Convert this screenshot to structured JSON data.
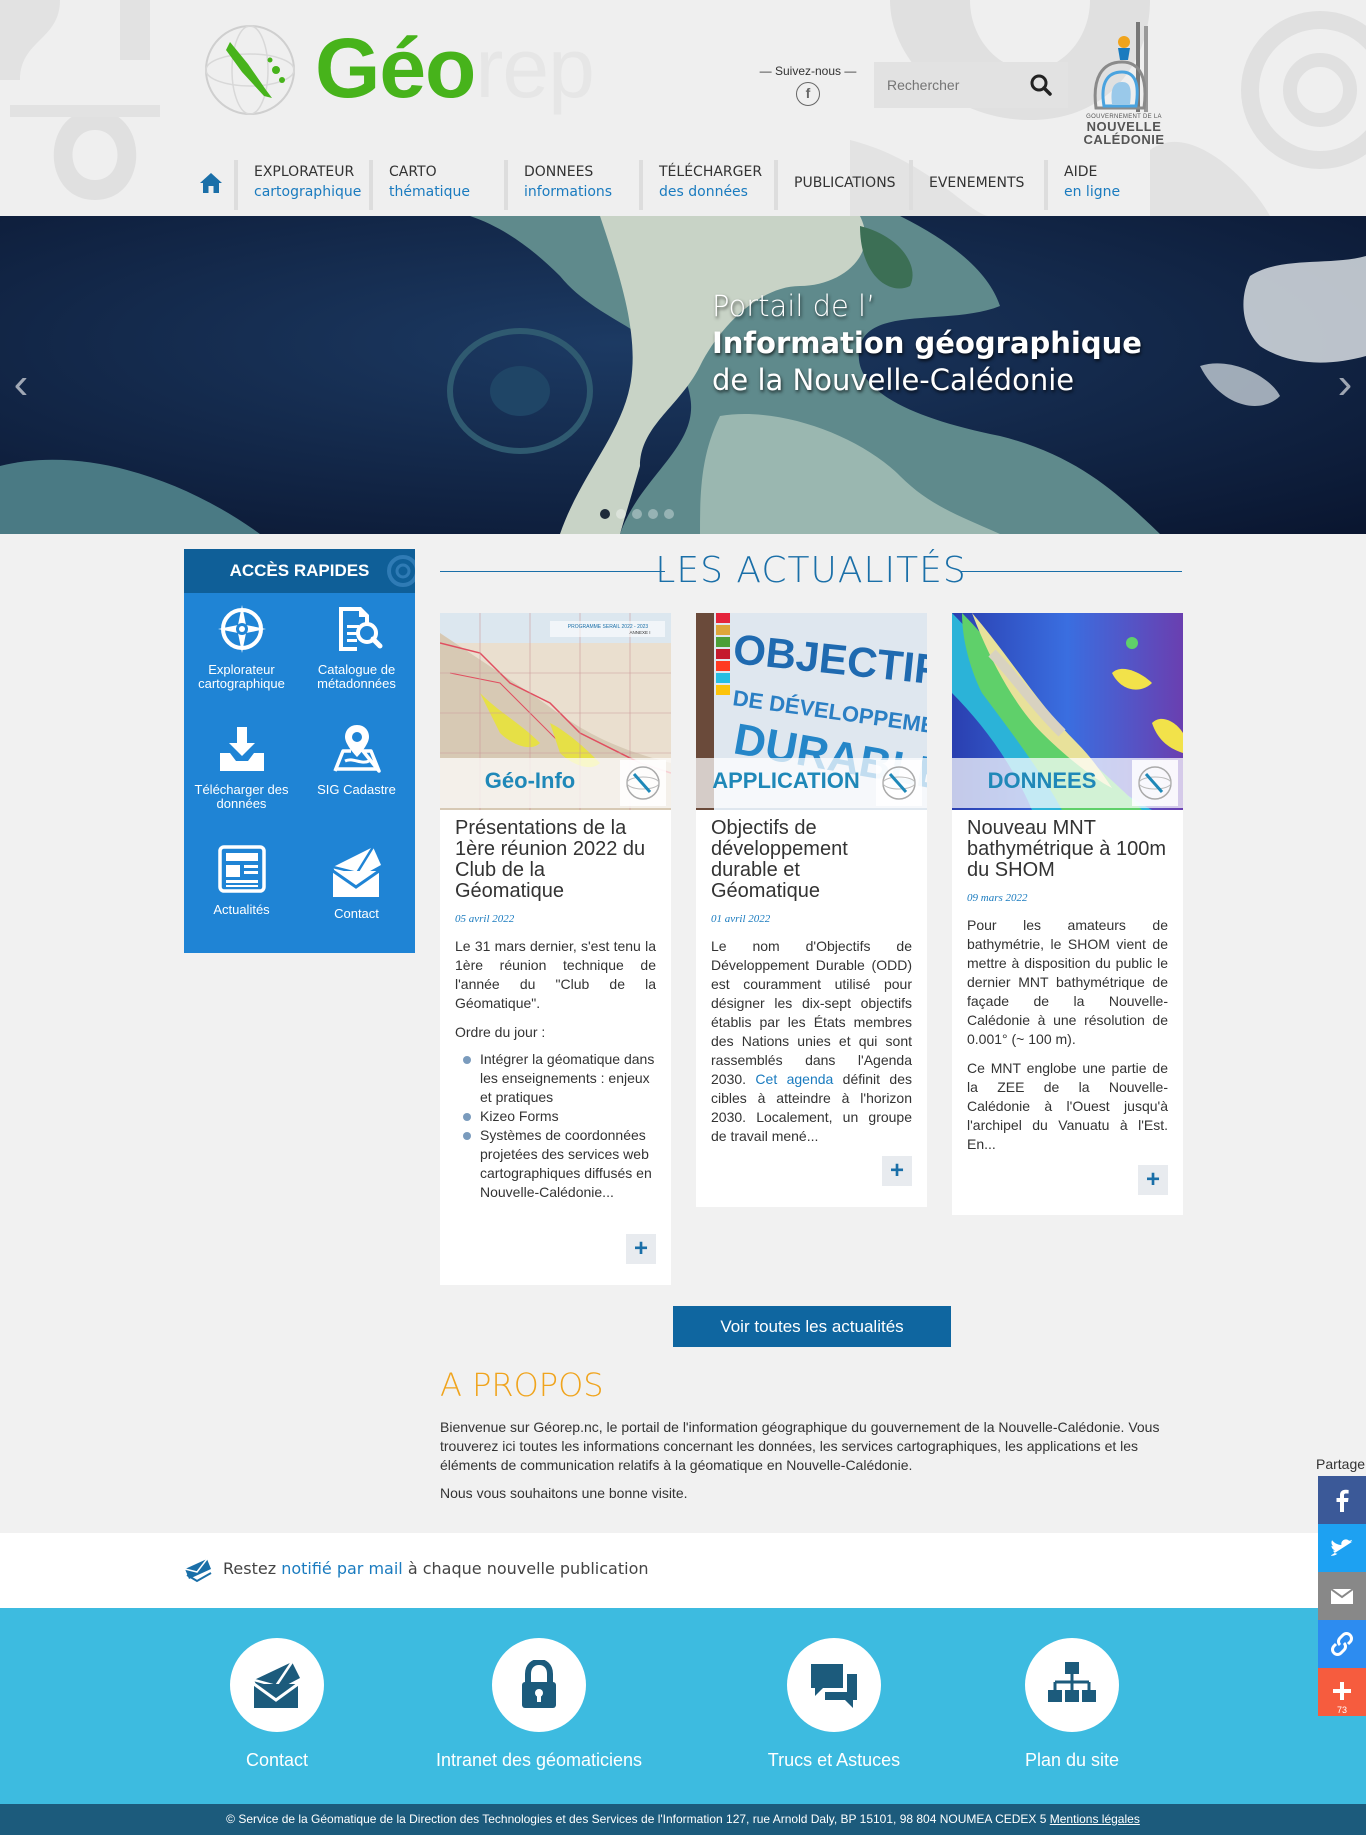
{
  "header": {
    "logo": {
      "part1": "Géo",
      "part2": "rep"
    },
    "follow_label": "Suivez-nous",
    "follow_icon": "facebook-icon",
    "search_placeholder": "Rechercher",
    "gov_logo": {
      "line1": "GOUVERNEMENT DE LA",
      "line2": "NOUVELLE",
      "line3": "CALÉDONIE"
    }
  },
  "nav": {
    "home_icon": "home-icon",
    "items": [
      {
        "line1": "EXPLORATEUR",
        "line2": "cartographique"
      },
      {
        "line1": "CARTO",
        "line2": "thématique"
      },
      {
        "line1": "DONNEES",
        "line2": "informations"
      },
      {
        "line1": "TÉLÉCHARGER",
        "line2": "des données"
      },
      {
        "line1": "PUBLICATIONS",
        "line2": ""
      },
      {
        "line1": "EVENEMENTS",
        "line2": ""
      },
      {
        "line1": "AIDE",
        "line2": "en ligne"
      }
    ]
  },
  "banner": {
    "line1": "Portail de l’",
    "line2": "Information géographique",
    "line3": "de la Nouvelle-Calédonie",
    "prev": "‹",
    "next": "›"
  },
  "quick": {
    "title": "ACCÈS RAPIDES",
    "items": [
      {
        "label": "Explorateur cartographique",
        "icon": "compass-icon"
      },
      {
        "label": "Catalogue de métadonnées",
        "icon": "document-search-icon"
      },
      {
        "label": "Télécharger des données",
        "icon": "download-tray-icon"
      },
      {
        "label": "SIG Cadastre",
        "icon": "map-pin-icon"
      },
      {
        "label": "Actualités",
        "icon": "newspaper-icon"
      },
      {
        "label": "Contact",
        "icon": "envelope-icon"
      }
    ]
  },
  "news": {
    "title": "LES ACTUALITÉS",
    "cards": [
      {
        "band": "Géo-Info",
        "title": "Présentations de la 1ère réunion 2022 du Club de la Géomatique",
        "date": "05 avril 2022",
        "text": "Le 31 mars dernier, s'est tenu la 1ère réunion technique de l'année du \"Club de la Géomatique\".",
        "text2": "Ordre du jour :",
        "list": [
          "Intégrer la géomatique dans les enseignements : enjeux et pratiques",
          "Kizeo Forms",
          "Systèmes de coordonnées projetées des services web cartographiques diffusés en Nouvelle-Calédonie..."
        ],
        "img_text": "PROGRAMME SERAIL 2022 - 2023\nANNEXE I"
      },
      {
        "band": "APPLICATION",
        "title": "Objectifs de développement durable et Géomatique",
        "date": "01 avril 2022",
        "text_a": "Le nom d'Objectifs de Développement Durable (ODD) est couramment utilisé pour désigner les dix-sept objectifs établis par les États membres des Nations unies et qui sont rassemblés dans l'Agenda 2030. ",
        "link": "Cet agenda",
        "text_b": " définit des cibles à atteindre à l'horizon 2030. Localement, un groupe de travail mené...",
        "img_text1": "OBJECTIFS",
        "img_text2": "DE DÉVELOPPEMENT",
        "img_text3": "DURABLE"
      },
      {
        "band": "DONNEES",
        "title": "Nouveau MNT bathymétrique à 100m du SHOM",
        "date": "09 mars 2022",
        "text": "Pour les amateurs de bathymétrie, le SHOM vient de mettre à disposition du public le dernier MNT bathymétrique de façade de la Nouvelle-Calédonie à une résolution de 0.001° (~ 100 m).",
        "text2": "Ce MNT englobe une partie de la ZEE de la Nouvelle-Calédonie à l'Ouest jusqu'à l'archipel du Vanuatu à l'Est. En..."
      }
    ],
    "more": "+",
    "all_button": "Voir toutes les actualités"
  },
  "about": {
    "title": "A PROPOS",
    "p1": "Bienvenue sur Géorep.nc, le portail de l'information géographique du gouvernement de la Nouvelle-Calédonie. Vous trouverez ici toutes les informations concernant les données, les services cartographiques, les applications et les éléments de communication relatifs à la géomatique en Nouvelle-Calédonie.",
    "p2": "Nous vous souhaitons une bonne visite."
  },
  "notify": {
    "pre": "Restez ",
    "link": "notifié par mail",
    "post": " à chaque nouvelle publication"
  },
  "footer_links": [
    {
      "label": "Contact",
      "icon": "envelope-icon"
    },
    {
      "label": "Intranet des géomaticiens",
      "icon": "lock-icon"
    },
    {
      "label": "Trucs et Astuces",
      "icon": "chat-bubbles-icon"
    },
    {
      "label": "Plan du site",
      "icon": "sitemap-icon"
    }
  ],
  "copyright": {
    "text": "©  Service de la Géomatique de la Direction des Technologies et des Services de l'Information    127, rue Arnold Daly, BP 15101, 98 804 NOUMEA CEDEX 5   ",
    "legal": "Mentions légales"
  },
  "share": {
    "label": "Partage",
    "count": "73",
    "colors": {
      "facebook": "#3b5998",
      "twitter": "#1da1f2",
      "email": "#888888",
      "link": "#2d8cf0",
      "more": "#f65c3e"
    }
  },
  "colors": {
    "brand_green": "#47b31b",
    "accent_blue": "#1a7bbf",
    "quick_blue": "#1f84d5",
    "orange": "#f0a41d",
    "footer_blue": "#3dbbe0"
  }
}
